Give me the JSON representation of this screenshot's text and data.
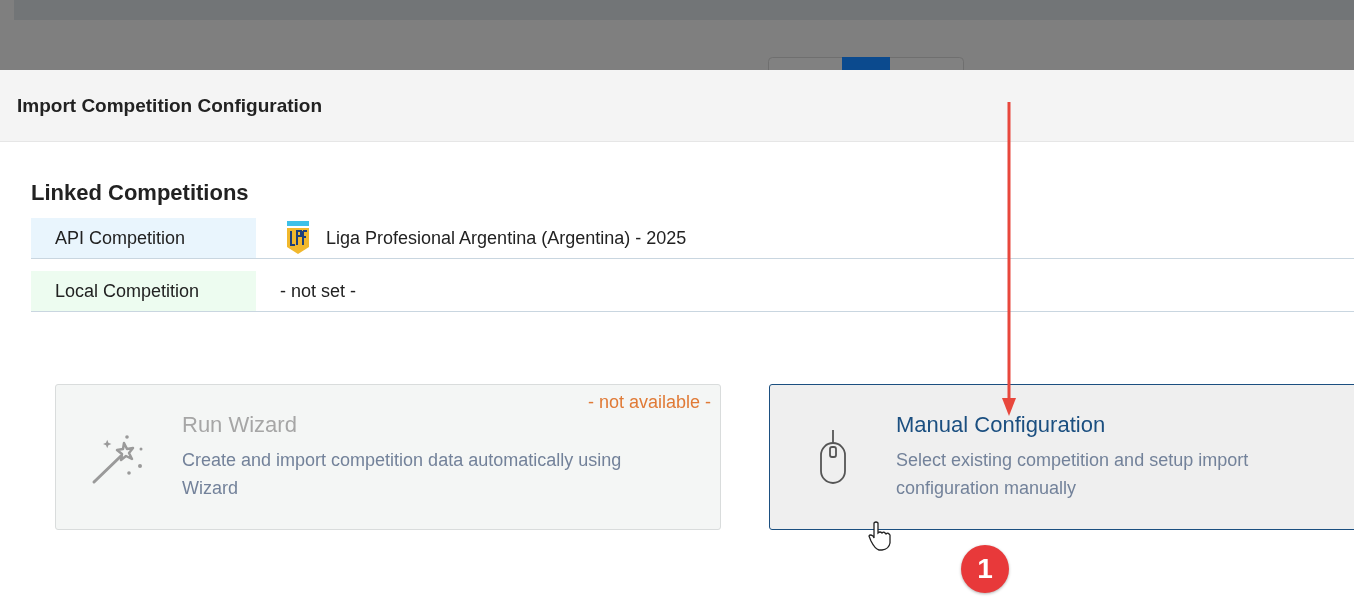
{
  "modal": {
    "title": "Import Competition Configuration"
  },
  "linked": {
    "heading": "Linked Competitions",
    "rows": [
      {
        "label": "API Competition",
        "kind": "logo",
        "value": "Liga Profesional Argentina (Argentina) - 2025",
        "color": "#e9f5fd"
      },
      {
        "label": "Local Competition",
        "kind": "plain",
        "value": "- not set -",
        "color": "#edfcf0"
      }
    ]
  },
  "options": [
    {
      "kind": "wand",
      "title": "Run Wizard",
      "description": "Create and import competition data automatically using Wizard",
      "badge": "- not available -",
      "disabled": true,
      "selected": false
    },
    {
      "kind": "mouse",
      "title": "Manual Configuration",
      "description": "Select existing competition and setup import configuration manually",
      "disabled": false,
      "selected": true
    }
  ],
  "annotation": {
    "number": "1"
  }
}
